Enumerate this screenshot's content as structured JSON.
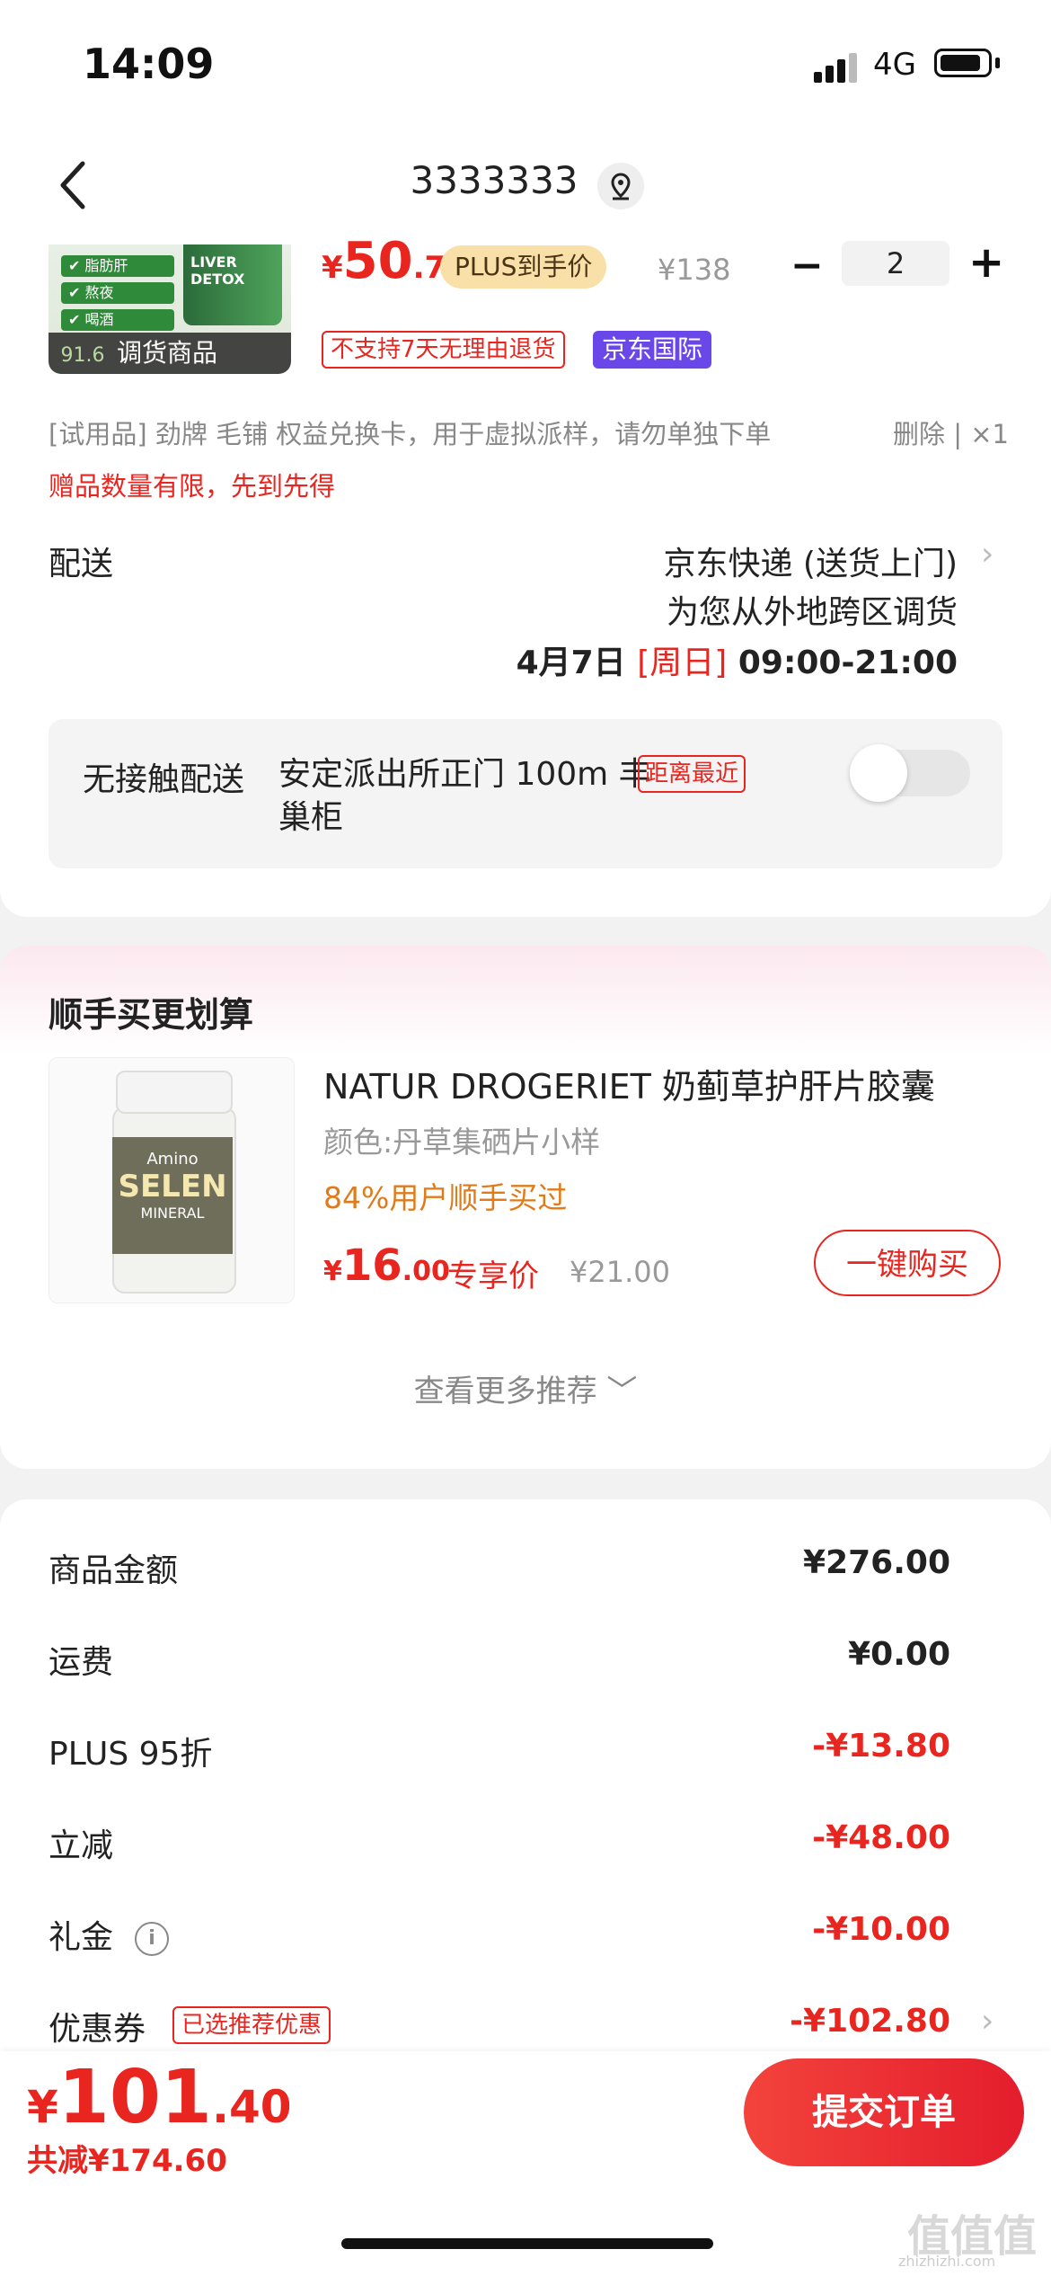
{
  "status": {
    "time": "14:09",
    "network": "4G"
  },
  "nav": {
    "title": "3333333"
  },
  "product": {
    "thumb_checks": [
      "脂肪肝",
      "熬夜",
      "喝酒"
    ],
    "thumb_bottle_text": "LIVER DETOX",
    "thumb_discount": "91.6",
    "thumb_tag": "调货商品",
    "price_symbol": "¥",
    "price_int": "50",
    "price_dec": ".7",
    "plus_tag": "PLUS到手价",
    "original": "¥138",
    "quantity": "2",
    "no_return_badge": "不支持7天无理由退货",
    "intl_badge": "京东国际"
  },
  "trial": {
    "text": "[试用品] 劲牌 毛铺 权益兑换卡，用于虚拟派样，请勿单独下单",
    "action": "删除 | ×1"
  },
  "gift_note": "赠品数量有限，先到先得",
  "delivery": {
    "label": "配送",
    "method": "京东快递 (送货上门)",
    "note": "为您从外地跨区调货",
    "date": "4月7日",
    "weekday": "[周日]",
    "window": "09:00-21:00"
  },
  "contactless": {
    "label": "无接触配送",
    "address": "安定派出所正门 100m 丰巢柜",
    "nearest": "距离最近",
    "enabled": false
  },
  "recommend": {
    "title": "顺手买更划算",
    "item": {
      "name": "NATUR DROGERIET 奶蓟草护肝片胶囊",
      "spec": "颜色:丹草集硒片小样",
      "buyers": "84%用户顺手买过",
      "price_symbol": "¥",
      "price_int": "16",
      "price_dec": ".00",
      "exclusive": "专享价",
      "original": "¥21.00",
      "buy_button": "一键购买",
      "jar_brand": "Amino",
      "jar_name": "SELEN",
      "jar_sub": "MINERAL"
    },
    "more": "查看更多推荐"
  },
  "summary": {
    "rows": [
      {
        "label": "商品金额",
        "value": "¥276.00"
      },
      {
        "label": "运费",
        "value": "¥0.00"
      },
      {
        "label": "PLUS 95折",
        "value": "-¥13.80"
      },
      {
        "label": "立减",
        "value": "-¥48.00"
      },
      {
        "label": "礼金",
        "value": "-¥10.00"
      },
      {
        "label": "优惠券",
        "value": "-¥102.80"
      }
    ],
    "coupon_tag": "已选推荐优惠"
  },
  "footer": {
    "currency": "¥",
    "total_int": "101",
    "total_dec": ".40",
    "saved": "共减¥174.60",
    "submit": "提交订单"
  },
  "watermark": {
    "main": "值值值",
    "sub": "zhizhizhi.com"
  },
  "colors": {
    "accent": "#e8251f",
    "plus_gold": "#f8e0a8",
    "intl_purple": "#6a47e8"
  }
}
